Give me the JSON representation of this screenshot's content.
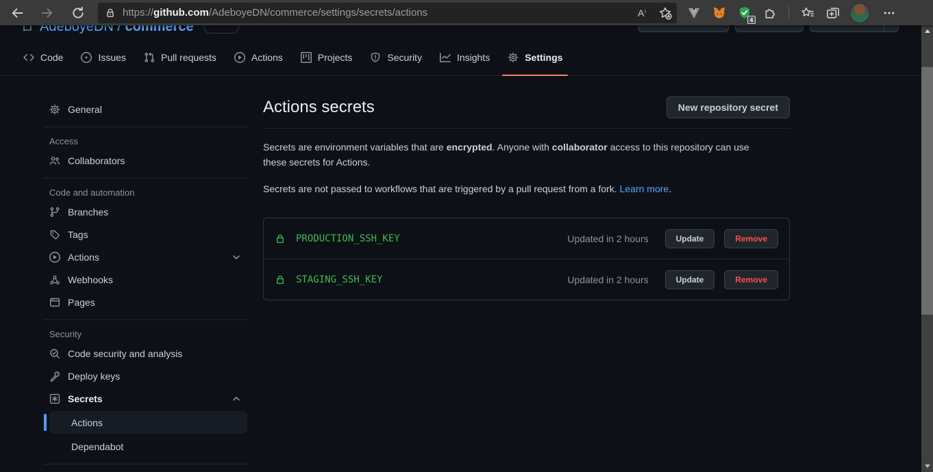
{
  "browser": {
    "url": {
      "protocol": "https://",
      "domain": "github.com",
      "path": "/AdeboyeDN/commerce/settings/secrets/actions"
    },
    "read_aloud_label": "A",
    "extensions_badge": "4"
  },
  "repo_header": {
    "owner": "AdeboyeDN",
    "separator": " / ",
    "name": "commerce"
  },
  "nav": {
    "tabs": [
      {
        "label": "Code"
      },
      {
        "label": "Issues"
      },
      {
        "label": "Pull requests"
      },
      {
        "label": "Actions"
      },
      {
        "label": "Projects"
      },
      {
        "label": "Security"
      },
      {
        "label": "Insights"
      },
      {
        "label": "Settings",
        "active": true
      }
    ]
  },
  "sidebar": {
    "general": {
      "label": "General"
    },
    "access": {
      "header": "Access",
      "collaborators": "Collaborators"
    },
    "code_automation": {
      "header": "Code and automation",
      "branches": "Branches",
      "tags": "Tags",
      "actions": "Actions",
      "webhooks": "Webhooks",
      "pages": "Pages"
    },
    "security": {
      "header": "Security",
      "code_security": "Code security and analysis",
      "deploy_keys": "Deploy keys",
      "secrets": "Secrets",
      "secrets_actions": "Actions",
      "dependabot": "Dependabot"
    }
  },
  "main": {
    "title": "Actions secrets",
    "new_secret_button": "New repository secret",
    "intro": {
      "part1": "Secrets are environment variables that are ",
      "bold1": "encrypted",
      "part2": ". Anyone with ",
      "bold2": "collaborator",
      "part3": " access to this repository can use these secrets for Actions."
    },
    "fork_note": {
      "text": "Secrets are not passed to workflows that are triggered by a pull request from a fork. ",
      "link": "Learn more",
      "suffix": "."
    },
    "secrets": [
      {
        "name": "PRODUCTION_SSH_KEY",
        "updated": "Updated in 2 hours",
        "update_label": "Update",
        "remove_label": "Remove"
      },
      {
        "name": "STAGING_SSH_KEY",
        "updated": "Updated in 2 hours",
        "update_label": "Update",
        "remove_label": "Remove"
      }
    ]
  },
  "colors": {
    "settings_underline": "#f78166",
    "link": "#58a6ff",
    "success_green": "#3fb950",
    "danger_red": "#f85149",
    "active_indicator": "#539bf5"
  }
}
